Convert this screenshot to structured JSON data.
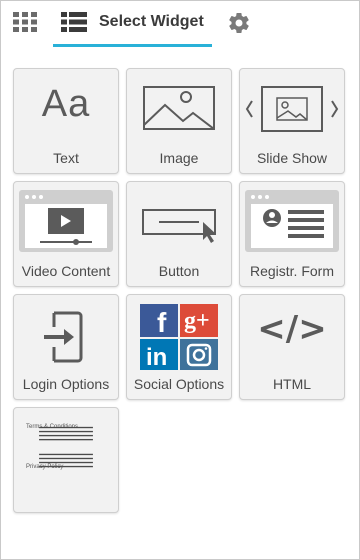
{
  "header": {
    "select_widget_label": "Select Widget"
  },
  "widgets": [
    {
      "label": "Text",
      "icon": "text-format-icon",
      "glyph": "Aa"
    },
    {
      "label": "Image",
      "icon": "image-icon"
    },
    {
      "label": "Slide Show",
      "icon": "slideshow-icon"
    },
    {
      "label": "Video Content",
      "icon": "video-icon"
    },
    {
      "label": "Button",
      "icon": "button-cursor-icon"
    },
    {
      "label": "Registr. Form",
      "icon": "registration-form-icon"
    },
    {
      "label": "Login Options",
      "icon": "login-icon"
    },
    {
      "label": "Social Options",
      "icon": "social-icons"
    },
    {
      "label": "HTML",
      "icon": "code-icon",
      "glyph": "</>"
    },
    {
      "label": "",
      "icon": "terms-document-icon",
      "small_text": [
        "Terms & Conditions",
        "Privacy Policy"
      ]
    }
  ],
  "colors": {
    "accent": "#29b1d8",
    "icon_gray": "#5b5b5b",
    "facebook": "#3b5998",
    "google_plus": "#dd4b39",
    "linkedin": "#0077b5",
    "instagram": "#3f729b"
  }
}
